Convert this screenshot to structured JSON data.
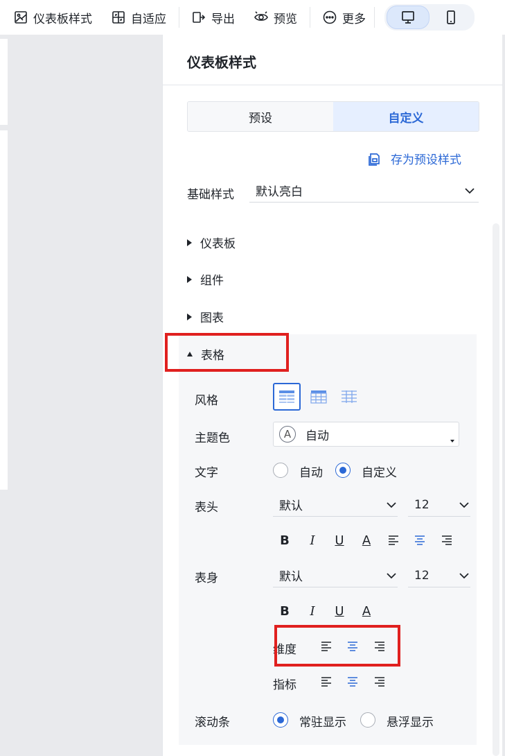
{
  "toolbar": {
    "dashboard_style": "仪表板样式",
    "adaptive": "自适应",
    "export": "导出",
    "preview": "预览",
    "more": "更多"
  },
  "panel": {
    "title": "仪表板样式",
    "tabs": [
      {
        "label": "预设",
        "active": false
      },
      {
        "label": "自定义",
        "active": true
      }
    ],
    "save_preset": "存为预设样式",
    "base_style_label": "基础样式",
    "base_style_value": "默认亮白",
    "sections": {
      "dashboard": "仪表板",
      "component": "组件",
      "chart": "图表",
      "table": "表格"
    },
    "table": {
      "style_label": "风格",
      "theme_label": "主题色",
      "theme_value": "自动",
      "theme_icon_letter": "A",
      "text_label": "文字",
      "text_auto": "自动",
      "text_custom": "自定义",
      "header_label": "表头",
      "header_font": "默认",
      "header_size": "12",
      "body_label": "表身",
      "body_font": "默认",
      "body_size": "12",
      "dimension_label": "维度",
      "metric_label": "指标",
      "scrollbar_label": "滚动条",
      "scroll_always": "常驻显示",
      "scroll_hover": "悬浮显示",
      "format_letters": {
        "bold": "B",
        "italic": "I",
        "underline": "U",
        "color": "A"
      }
    }
  },
  "colors": {
    "accent": "#2b68d6",
    "highlight": "#e0201f"
  }
}
